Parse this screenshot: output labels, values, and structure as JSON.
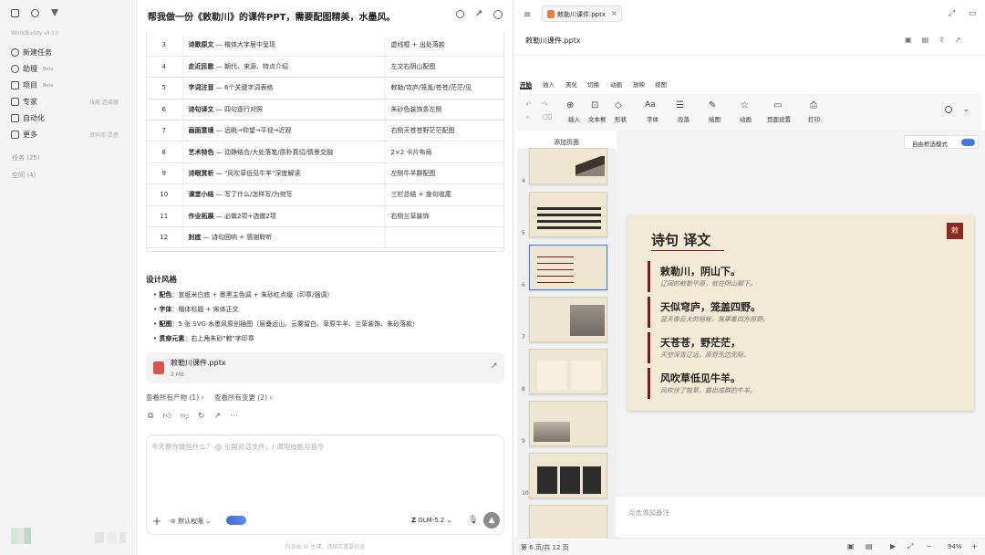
{
  "sidebar": {
    "app_name": "WorkBuddy",
    "version": "v4.3.0",
    "items": [
      {
        "label": "新建任务"
      },
      {
        "label": "助理",
        "tag": "Beta"
      },
      {
        "label": "项目",
        "tag": "Beta"
      },
      {
        "label": "专家",
        "right": "技能·连接器"
      },
      {
        "label": "自动化"
      },
      {
        "label": "更多",
        "right": "资料库·灵感"
      }
    ],
    "tasks": "任务 (25)",
    "spaces": "空间 (4)"
  },
  "chat": {
    "title": "帮我做一份《敕勒川》的课件PPT，需要配图精美，水墨风。",
    "plan_rows": [
      {
        "n": "3",
        "bold": "诗歌原文",
        "rest": " — 楷体大字居中呈现",
        "right": "虚线框 + 出处落款"
      },
      {
        "n": "4",
        "bold": "走近民歌",
        "rest": " — 朝代、来源、特点介绍",
        "right": "左文右阴山配图"
      },
      {
        "n": "5",
        "bold": "字词注音",
        "rest": " — 6个关键字词表格",
        "right": "敕勒/穹庐/笼盖/苍苍/茫茫/见"
      },
      {
        "n": "6",
        "bold": "诗句译文",
        "rest": " — 四句逐行对照",
        "right": "朱砂色装饰条左侧"
      },
      {
        "n": "7",
        "bold": "画面意境",
        "rest": " — 远眺→仰望→平视→近观",
        "right": "右侧天苍苍野茫茫配图"
      },
      {
        "n": "8",
        "bold": "艺术特色",
        "rest": " — 动静结合/大处落笔/质朴真切/情景交融",
        "right": "2×2 卡片布局"
      },
      {
        "n": "9",
        "bold": "诗眼赏析",
        "rest": " — \"风吹草低见牛羊\"深度解读",
        "right": "左侧牛羊群配图"
      },
      {
        "n": "10",
        "bold": "课堂小结",
        "rest": " — 写了什么/怎样写/为何写",
        "right": "三栏总结 + 金句收尾"
      },
      {
        "n": "11",
        "bold": "作业拓展",
        "rest": " — 必做2项+选做2项",
        "right": "右侧兰草装饰"
      },
      {
        "n": "12",
        "bold": "封底",
        "rest": " — 诗句回响 + 感谢聆听",
        "right": ""
      }
    ],
    "design_title": "设计风格",
    "design": [
      {
        "k": "配色",
        "v": "：宣纸米白底 + 墨黑主色调 + 朱砂红点缀（印章/强调）"
      },
      {
        "k": "字体",
        "v": "：楷体标题 + 宋体正文"
      },
      {
        "k": "配图",
        "v": "：5 张 SVG 水墨风原创插图（层叠远山、云雾留白、草原牛羊、兰草装饰、朱砂落款）"
      },
      {
        "k": "贯穿元素",
        "v": "：右上角朱砂\"敕\"字印章"
      }
    ],
    "file": {
      "name": "敕勒川课件.pptx",
      "size": "3 MB"
    },
    "view_outputs": "查看所有产物 (1)",
    "view_changes": "查看所有变更 (2)",
    "input_placeholder": "今天帮你做些什么？ @ 引用对话文件，/ 调用技能与指令",
    "permission": "默认权限",
    "model": "GLM-5.2",
    "footer": "内容由 AI 生成，请核实重要信息"
  },
  "ppt": {
    "tab": "敕勒川课件.pptx",
    "filename": "敕勒川课件.pptx",
    "menu": [
      "开始",
      "插入",
      "美化",
      "切换",
      "动画",
      "放映",
      "视图"
    ],
    "tools": [
      "插入",
      "文本框",
      "形状",
      "字体",
      "段落",
      "绘图",
      "动画",
      "页面设置",
      "打印"
    ],
    "add_page": "添加页面",
    "free_mode": "自由框选模式",
    "thumbs": [
      "4",
      "5",
      "6",
      "7",
      "8",
      "9",
      "10"
    ],
    "slide": {
      "title": "诗句 译文",
      "seal": "敕",
      "lines": [
        {
          "p": "敕勒川，阴山下。",
          "t": "辽阔的敕勒平原，就在阴山脚下。"
        },
        {
          "p": "天似穹庐，笼盖四野。",
          "t": "蓝天像巨大的毡帐，笼罩着四方原野。"
        },
        {
          "p": "天苍苍，野茫茫，",
          "t": "天空深青辽远，原野无边无际，"
        },
        {
          "p": "风吹草低见牛羊。",
          "t": "风吹伏了牧草，露出成群的牛羊。"
        }
      ]
    },
    "notes": "点击添加备注",
    "page_info": "第 6 页/共 12 页",
    "zoom": "94%"
  }
}
